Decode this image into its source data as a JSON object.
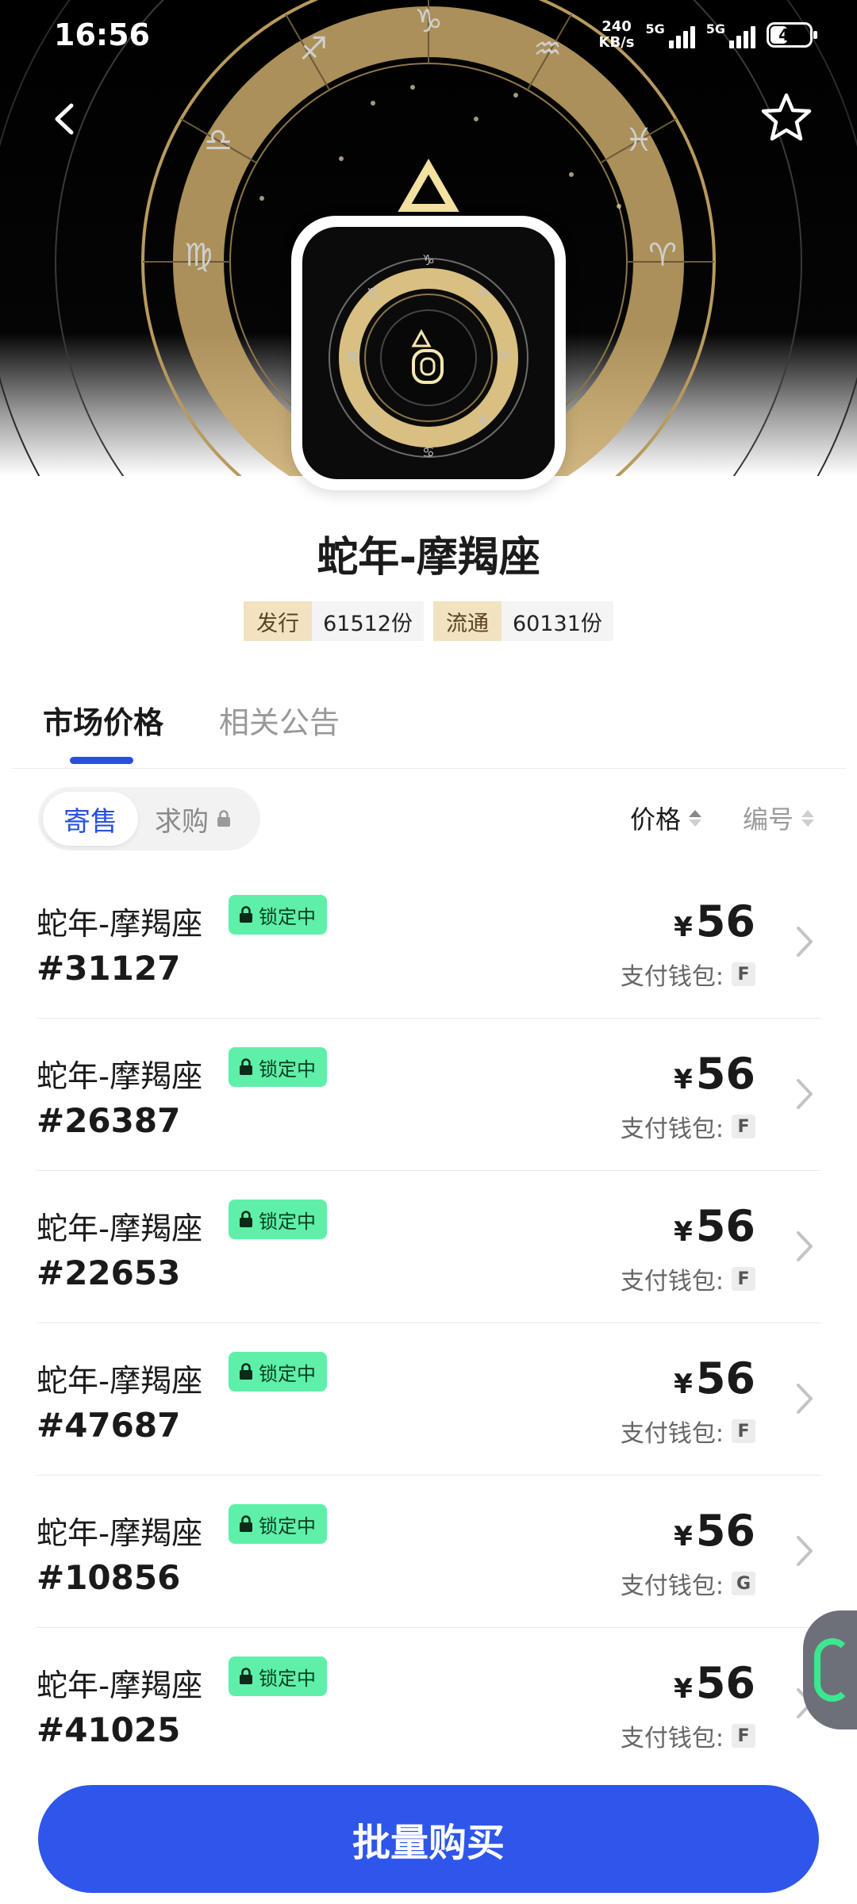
{
  "status_bar": {
    "time": "16:56",
    "net_speed_top": "240",
    "net_speed_bottom": "KB/s",
    "sim1": "5G",
    "sim2": "5G",
    "battery": "41"
  },
  "header": {
    "back_icon": "chevron-left-icon",
    "favorite_icon": "star-outline-icon"
  },
  "collection": {
    "title": "蛇年-摩羯座",
    "issued_label": "发行",
    "issued_value": "61512份",
    "circulating_label": "流通",
    "circulating_value": "60131份"
  },
  "tabs": [
    {
      "label": "市场价格",
      "active": true
    },
    {
      "label": "相关公告",
      "active": false
    }
  ],
  "filters": {
    "segment_sell": "寄售",
    "segment_buy": "求购",
    "sort_price": "价格",
    "sort_number": "编号"
  },
  "listings": [
    {
      "name": "蛇年-摩羯座",
      "badge": "锁定中",
      "serial": "#31127",
      "currency": "¥",
      "price": "56",
      "wallet_label": "支付钱包:",
      "wallet_code": "F"
    },
    {
      "name": "蛇年-摩羯座",
      "badge": "锁定中",
      "serial": "#26387",
      "currency": "¥",
      "price": "56",
      "wallet_label": "支付钱包:",
      "wallet_code": "F"
    },
    {
      "name": "蛇年-摩羯座",
      "badge": "锁定中",
      "serial": "#22653",
      "currency": "¥",
      "price": "56",
      "wallet_label": "支付钱包:",
      "wallet_code": "F"
    },
    {
      "name": "蛇年-摩羯座",
      "badge": "锁定中",
      "serial": "#47687",
      "currency": "¥",
      "price": "56",
      "wallet_label": "支付钱包:",
      "wallet_code": "F"
    },
    {
      "name": "蛇年-摩羯座",
      "badge": "锁定中",
      "serial": "#10856",
      "currency": "¥",
      "price": "56",
      "wallet_label": "支付钱包:",
      "wallet_code": "G"
    },
    {
      "name": "蛇年-摩羯座",
      "badge": "锁定中",
      "serial": "#41025",
      "currency": "¥",
      "price": "56",
      "wallet_label": "支付钱包:",
      "wallet_code": "F"
    }
  ],
  "bottom": {
    "bulk_buy_label": "批量购买"
  },
  "colors": {
    "accent": "#2f56ea",
    "lock_badge": "#5ef0a8",
    "tag_bg": "#f2e2c0",
    "zodiac_gold": "#c9a96a"
  }
}
